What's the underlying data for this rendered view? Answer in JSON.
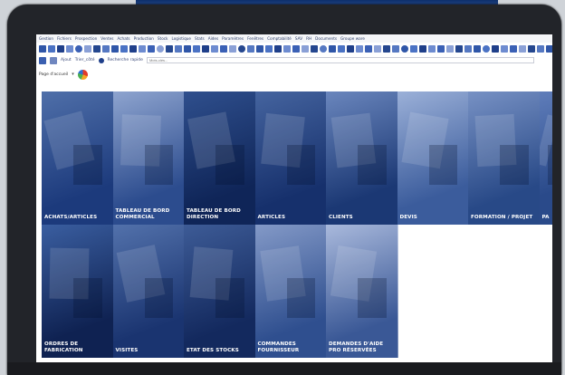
{
  "menu": [
    "Gestion",
    "Fichiers",
    "Prospection",
    "Ventes",
    "Achats",
    "Production",
    "Stock",
    "Logistique",
    "Stats",
    "Aides",
    "Paramètres",
    "Fenêtres",
    "Comptabilité",
    "SAV",
    "RH",
    "Documents",
    "Groupe ware"
  ],
  "toolbar2": {
    "label_a": "Ajout",
    "label_b": "Trier_côté",
    "label_c": "Recherche rapide",
    "search_placeholder": "Mots-clés..."
  },
  "toolbar3": {
    "label": "Page d'accueil"
  },
  "tiles": [
    {
      "label": "ACHATS/ARTICLES"
    },
    {
      "label": "TABLEAU DE BORD COMMERCIAL"
    },
    {
      "label": "TABLEAU DE BORD DIRECTION"
    },
    {
      "label": "ARTICLES"
    },
    {
      "label": "CLIENTS"
    },
    {
      "label": "DEVIS"
    },
    {
      "label": "FORMATION / PROJET"
    },
    {
      "label": "PA"
    },
    {
      "label": "ORDRES DE FABRICATION"
    },
    {
      "label": "VISITES"
    },
    {
      "label": "ETAT DES STOCKS"
    },
    {
      "label": "COMMANDES FOURNISSEUR"
    },
    {
      "label": "DEMANDES D'AIDE PRO RÉSERVÉES"
    }
  ],
  "colors": {
    "tile_dark": "#1a2f66",
    "tile_mid": "#34538e",
    "tile_light": "#6f8bc0"
  }
}
